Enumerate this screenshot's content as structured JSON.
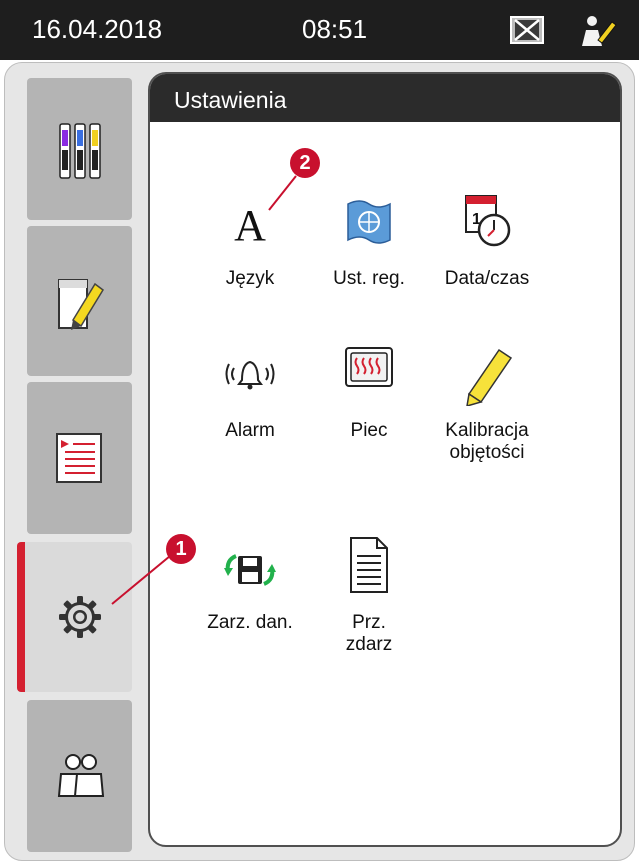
{
  "status_bar": {
    "date": "16.04.2018",
    "time": "08:51"
  },
  "panel": {
    "title": "Ustawienia"
  },
  "settings_items": [
    {
      "label": "Język",
      "icon": "language-icon"
    },
    {
      "label": "Ust. reg.",
      "icon": "region-flag-icon"
    },
    {
      "label": "Data/czas",
      "icon": "calendar-clock-icon"
    },
    {
      "label": "Alarm",
      "icon": "bell-alarm-icon"
    },
    {
      "label": "Piec",
      "icon": "oven-icon"
    },
    {
      "label": "Kalibracja objętości",
      "icon": "marker-pen-icon"
    },
    {
      "label": "Zarz. dan.",
      "icon": "floppy-sync-icon"
    },
    {
      "label": "Prz. zdarz",
      "icon": "document-icon"
    }
  ],
  "sidebar": {
    "items": [
      {
        "name": "reagents",
        "icon": "reagent-bottles-icon"
      },
      {
        "name": "pen-status",
        "icon": "pen-check-icon"
      },
      {
        "name": "programs",
        "icon": "program-list-icon"
      },
      {
        "name": "settings",
        "icon": "gear-icon",
        "active": true
      },
      {
        "name": "user",
        "icon": "user-group-icon"
      }
    ]
  },
  "callouts": [
    "1",
    "2"
  ],
  "colors": {
    "accent": "#d42030",
    "header": "#2b2b2b",
    "sidebar": "#b4b4b4"
  }
}
